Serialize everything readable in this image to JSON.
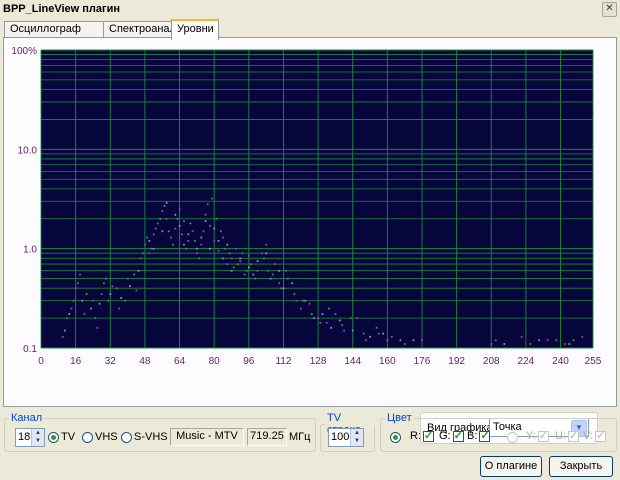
{
  "window": {
    "title": "BPP_LineView плагин",
    "close_glyph": "✕"
  },
  "tabs": [
    {
      "label": "Осциллограф"
    },
    {
      "label": "Спектроанализатор"
    },
    {
      "label": "Уровни"
    }
  ],
  "chart_data": {
    "type": "scatter",
    "yscale": "log",
    "ylim": [
      0.1,
      100
    ],
    "xlim": [
      0,
      255
    ],
    "y_ticks": [
      "100%",
      "10.0",
      "1.0",
      "0.1"
    ],
    "x_ticks": [
      0,
      16,
      32,
      48,
      64,
      80,
      96,
      112,
      128,
      144,
      160,
      176,
      192,
      208,
      224,
      240,
      255
    ],
    "grid": true,
    "background": "#06063c",
    "grid_color": "#1b8a3c",
    "series": [
      {
        "color": "#b03ab0",
        "points": [
          [
            10,
            0.13
          ],
          [
            14,
            0.25
          ],
          [
            16,
            0.4
          ],
          [
            18,
            0.55
          ],
          [
            20,
            0.22
          ],
          [
            24,
            0.3
          ],
          [
            26,
            0.16
          ],
          [
            28,
            0.35
          ],
          [
            30,
            0.5
          ],
          [
            33,
            0.42
          ],
          [
            36,
            0.25
          ],
          [
            40,
            0.5
          ],
          [
            44,
            0.38
          ],
          [
            46,
            0.8
          ],
          [
            48,
            1.1
          ],
          [
            50,
            0.9
          ],
          [
            52,
            1.4
          ],
          [
            54,
            1.8
          ],
          [
            56,
            2.4
          ],
          [
            58,
            2.0
          ],
          [
            60,
            1.3
          ],
          [
            62,
            1.6
          ],
          [
            64,
            2.5
          ],
          [
            66,
            1.9
          ],
          [
            68,
            1.2
          ],
          [
            70,
            1.5
          ],
          [
            72,
            0.9
          ],
          [
            74,
            1.1
          ],
          [
            76,
            2.2
          ],
          [
            78,
            1.7
          ],
          [
            80,
            1.2
          ],
          [
            82,
            0.95
          ],
          [
            84,
            1.3
          ],
          [
            86,
            0.7
          ],
          [
            88,
            0.8
          ],
          [
            90,
            1.0
          ],
          [
            92,
            0.75
          ],
          [
            94,
            0.55
          ],
          [
            96,
            0.85
          ],
          [
            100,
            0.6
          ],
          [
            102,
            0.9
          ],
          [
            104,
            1.1
          ],
          [
            108,
            0.7
          ],
          [
            110,
            0.45
          ],
          [
            114,
            0.5
          ],
          [
            118,
            0.3
          ],
          [
            120,
            0.25
          ],
          [
            124,
            0.28
          ],
          [
            128,
            0.2
          ],
          [
            132,
            0.18
          ],
          [
            136,
            0.22
          ],
          [
            140,
            0.15
          ],
          [
            146,
            0.2
          ],
          [
            150,
            0.12
          ],
          [
            156,
            0.14
          ],
          [
            162,
            0.13
          ],
          [
            176,
            0.12
          ],
          [
            208,
            0.11
          ],
          [
            222,
            0.13
          ],
          [
            234,
            0.12
          ],
          [
            242,
            0.11
          ],
          [
            250,
            0.13
          ]
        ]
      },
      {
        "color": "#29a629",
        "points": [
          [
            12,
            0.2
          ],
          [
            15,
            0.3
          ],
          [
            17,
            0.45
          ],
          [
            21,
            0.35
          ],
          [
            25,
            0.2
          ],
          [
            29,
            0.45
          ],
          [
            31,
            0.3
          ],
          [
            35,
            0.4
          ],
          [
            39,
            0.3
          ],
          [
            43,
            0.55
          ],
          [
            47,
            0.9
          ],
          [
            49,
            1.3
          ],
          [
            51,
            1.0
          ],
          [
            53,
            1.6
          ],
          [
            55,
            2.0
          ],
          [
            57,
            2.7
          ],
          [
            59,
            1.5
          ],
          [
            61,
            1.1
          ],
          [
            63,
            2.0
          ],
          [
            65,
            1.4
          ],
          [
            67,
            1.0
          ],
          [
            69,
            1.8
          ],
          [
            71,
            1.2
          ],
          [
            73,
            0.8
          ],
          [
            75,
            1.5
          ],
          [
            77,
            2.8
          ],
          [
            79,
            3.2
          ],
          [
            81,
            2.0
          ],
          [
            83,
            1.5
          ],
          [
            85,
            1.0
          ],
          [
            87,
            0.9
          ],
          [
            89,
            0.65
          ],
          [
            91,
            0.7
          ],
          [
            93,
            0.9
          ],
          [
            95,
            0.6
          ],
          [
            97,
            0.7
          ],
          [
            99,
            0.5
          ],
          [
            103,
            0.8
          ],
          [
            105,
            0.6
          ],
          [
            107,
            0.55
          ],
          [
            111,
            0.4
          ],
          [
            113,
            0.6
          ],
          [
            117,
            0.35
          ],
          [
            121,
            0.3
          ],
          [
            125,
            0.22
          ],
          [
            129,
            0.18
          ],
          [
            133,
            0.25
          ],
          [
            139,
            0.17
          ],
          [
            143,
            0.2
          ],
          [
            149,
            0.14
          ],
          [
            155,
            0.16
          ],
          [
            160,
            0.12
          ],
          [
            168,
            0.11
          ],
          [
            210,
            0.12
          ],
          [
            226,
            0.11
          ],
          [
            238,
            0.12
          ],
          [
            246,
            0.12
          ]
        ]
      },
      {
        "color": "#8a8ad8",
        "points": [
          [
            11,
            0.15
          ],
          [
            13,
            0.22
          ],
          [
            19,
            0.3
          ],
          [
            23,
            0.25
          ],
          [
            27,
            0.28
          ],
          [
            32,
            0.35
          ],
          [
            37,
            0.32
          ],
          [
            41,
            0.42
          ],
          [
            45,
            0.6
          ],
          [
            50,
            1.2
          ],
          [
            52,
            1.0
          ],
          [
            56,
            1.5
          ],
          [
            58,
            2.9
          ],
          [
            62,
            2.2
          ],
          [
            64,
            1.7
          ],
          [
            66,
            1.1
          ],
          [
            68,
            1.4
          ],
          [
            72,
            1.0
          ],
          [
            74,
            1.3
          ],
          [
            76,
            1.9
          ],
          [
            78,
            1.0
          ],
          [
            80,
            1.6
          ],
          [
            82,
            1.2
          ],
          [
            84,
            0.8
          ],
          [
            86,
            1.1
          ],
          [
            88,
            0.6
          ],
          [
            92,
            0.8
          ],
          [
            96,
            0.65
          ],
          [
            98,
            0.55
          ],
          [
            100,
            0.75
          ],
          [
            104,
            0.9
          ],
          [
            106,
            0.5
          ],
          [
            110,
            0.6
          ],
          [
            112,
            0.4
          ],
          [
            116,
            0.45
          ],
          [
            122,
            0.3
          ],
          [
            126,
            0.2
          ],
          [
            130,
            0.22
          ],
          [
            134,
            0.16
          ],
          [
            138,
            0.19
          ],
          [
            144,
            0.15
          ],
          [
            152,
            0.13
          ],
          [
            158,
            0.14
          ],
          [
            166,
            0.12
          ],
          [
            172,
            0.12
          ],
          [
            214,
            0.11
          ],
          [
            230,
            0.12
          ],
          [
            244,
            0.11
          ]
        ]
      }
    ]
  },
  "view": {
    "label": "Вид графика:",
    "value": "Точка",
    "arrow_glyph": "▼"
  },
  "channel": {
    "legend": "Канал",
    "number": "18",
    "radios": [
      {
        "label": "TV",
        "selected": true
      },
      {
        "label": "VHS",
        "selected": false
      },
      {
        "label": "S-VHS",
        "selected": false
      }
    ],
    "station": "Music - MTV",
    "frequency": "719.25",
    "unit": "МГц"
  },
  "tv_line": {
    "legend": "TV строка",
    "value": "100"
  },
  "color": {
    "legend": "Цвет",
    "rgb_selected": true,
    "rgb": [
      {
        "label": "R:",
        "checked": true
      },
      {
        "label": "G:",
        "checked": true
      },
      {
        "label": "B:",
        "checked": true
      }
    ],
    "yuv_selected": false,
    "yuv": [
      {
        "label": "Y:",
        "checked": true
      },
      {
        "label": "U:",
        "checked": true
      },
      {
        "label": "V:",
        "checked": true
      }
    ]
  },
  "buttons": {
    "about": "О плагине",
    "close": "Закрыть"
  }
}
